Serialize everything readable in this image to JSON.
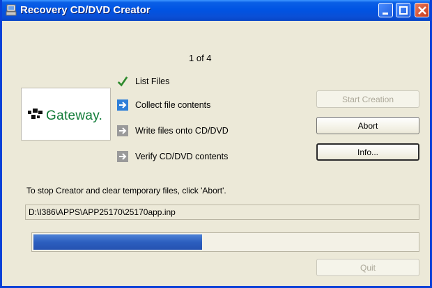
{
  "window": {
    "title": "Recovery CD/DVD Creator",
    "icons": [
      "app-icon",
      "minimize-icon",
      "maximize-icon",
      "close-icon"
    ]
  },
  "logo": {
    "text": "Gateway."
  },
  "step_counter": "1 of 4",
  "steps": [
    {
      "label": "List Files",
      "icon": "checkmark-icon",
      "status": "done"
    },
    {
      "label": "Collect file contents",
      "icon": "arrow-right-icon",
      "status": "active"
    },
    {
      "label": "Write files onto CD/DVD",
      "icon": "arrow-right-icon",
      "status": "pending"
    },
    {
      "label": "Verify CD/DVD contents",
      "icon": "arrow-right-icon",
      "status": "pending"
    }
  ],
  "buttons": {
    "start": "Start Creation",
    "abort": "Abort",
    "info": "Info...",
    "quit": "Quit"
  },
  "instruction": "To stop Creator and clear temporary files, click 'Abort'.",
  "current_file": "D:\\I386\\APPS\\APP25170\\25170app.inp",
  "progress": {
    "fraction": 0.44
  },
  "colors": {
    "titlebar": "#0054e3",
    "progress": "#2c5fbf",
    "check": "#2d8a2d",
    "arrow_active": "#2f7fd8",
    "arrow_pending": "#9a9a9a",
    "logo": "#0f7a36"
  }
}
